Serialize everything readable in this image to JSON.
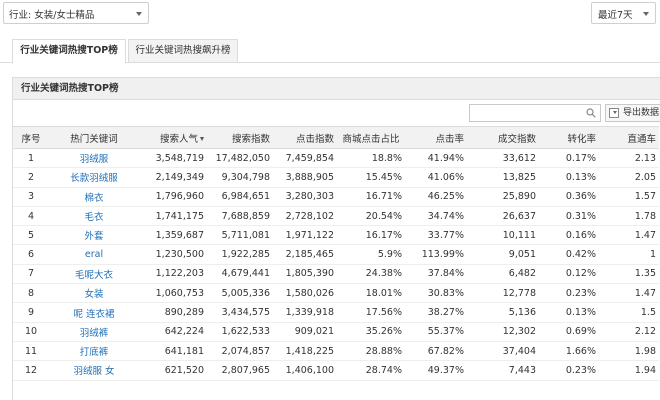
{
  "filters": {
    "industry": "行业: 女装/女士精品",
    "date_range": "最近7天"
  },
  "tabs": [
    {
      "label": "行业关键词热搜TOP榜",
      "active": true
    },
    {
      "label": "行业关键词热搜飙升榜",
      "active": false
    }
  ],
  "panel": {
    "title": "行业关键词热搜TOP榜",
    "search_placeholder": "",
    "export_label": "导出数据"
  },
  "table": {
    "columns": [
      "序号",
      "热门关键词",
      "搜索人气",
      "搜索指数",
      "点击指数",
      "商城点击占比",
      "点击率",
      "成交指数",
      "转化率",
      "直通车"
    ],
    "sorted_column": "搜索人气",
    "rows": [
      [
        "1",
        "羽绒服",
        "3,548,719",
        "17,482,050",
        "7,459,854",
        "18.8%",
        "41.94%",
        "33,612",
        "0.17%",
        "2.13"
      ],
      [
        "2",
        "长款羽绒服",
        "2,149,349",
        "9,304,798",
        "3,888,905",
        "15.45%",
        "41.06%",
        "13,825",
        "0.13%",
        "2.05"
      ],
      [
        "3",
        "棉衣",
        "1,796,960",
        "6,984,651",
        "3,280,303",
        "16.71%",
        "46.25%",
        "25,890",
        "0.36%",
        "1.57"
      ],
      [
        "4",
        "毛衣",
        "1,741,175",
        "7,688,859",
        "2,728,102",
        "20.54%",
        "34.74%",
        "26,637",
        "0.31%",
        "1.78"
      ],
      [
        "5",
        "外套",
        "1,359,687",
        "5,711,081",
        "1,971,122",
        "16.17%",
        "33.77%",
        "10,111",
        "0.16%",
        "1.47"
      ],
      [
        "6",
        "eral",
        "1,230,500",
        "1,922,285",
        "2,185,465",
        "5.9%",
        "113.99%",
        "9,051",
        "0.42%",
        "1"
      ],
      [
        "7",
        "毛呢大衣",
        "1,122,203",
        "4,679,441",
        "1,805,390",
        "24.38%",
        "37.84%",
        "6,482",
        "0.12%",
        "1.35"
      ],
      [
        "8",
        "女装",
        "1,060,753",
        "5,005,336",
        "1,580,026",
        "18.01%",
        "30.83%",
        "12,778",
        "0.23%",
        "1.47"
      ],
      [
        "9",
        "呢 连衣裙",
        "890,289",
        "3,434,575",
        "1,339,918",
        "17.56%",
        "38.27%",
        "5,136",
        "0.13%",
        "1.5"
      ],
      [
        "10",
        "羽绒裤",
        "642,224",
        "1,622,533",
        "909,021",
        "35.26%",
        "55.37%",
        "12,302",
        "0.69%",
        "2.12"
      ],
      [
        "11",
        "打底裤",
        "641,181",
        "2,074,857",
        "1,418,225",
        "28.88%",
        "67.82%",
        "37,404",
        "1.66%",
        "1.98"
      ],
      [
        "12",
        "羽绒服 女",
        "621,520",
        "2,807,965",
        "1,406,100",
        "28.74%",
        "49.37%",
        "7,443",
        "0.23%",
        "1.94"
      ]
    ]
  }
}
